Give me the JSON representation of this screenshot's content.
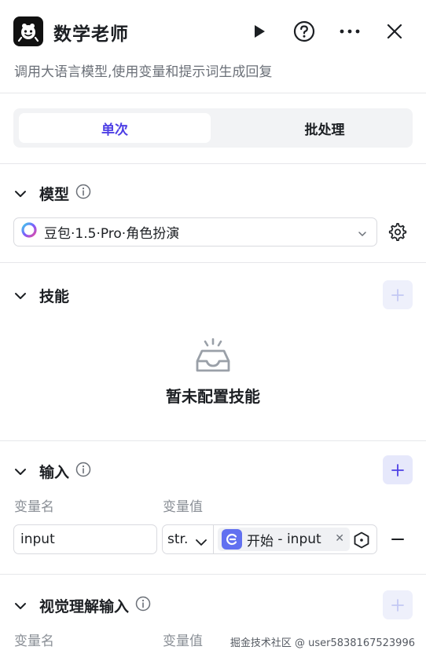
{
  "header": {
    "title": "数学老师",
    "description": "调用大语言模型,使用变量和提示词生成回复",
    "icons": [
      "robot-logo-icon",
      "play-icon",
      "help-icon",
      "more-icon",
      "close-icon"
    ]
  },
  "tabs": [
    {
      "label": "单次",
      "active": true
    },
    {
      "label": "批处理",
      "active": false
    }
  ],
  "model_section": {
    "title": "模型",
    "selected_model": "豆包·1.5·Pro·角色扮演"
  },
  "skills_section": {
    "title": "技能",
    "empty_text": "暂未配置技能"
  },
  "input_section": {
    "title": "输入",
    "col_name": "变量名",
    "col_value": "变量值",
    "rows": [
      {
        "name": "input",
        "type": "str.",
        "ref_node": "开始",
        "ref_sep": " - ",
        "ref_var": "input"
      }
    ]
  },
  "vision_section": {
    "title": "视觉理解输入",
    "col_name": "变量名",
    "col_value": "变量值"
  },
  "watermark": "掘金技术社区 @ user5838167523996",
  "colors": {
    "accent": "#4e40e5",
    "border": "#d9dadf",
    "muted_text": "#8a8f96",
    "ref_icon": "#6170f0"
  }
}
